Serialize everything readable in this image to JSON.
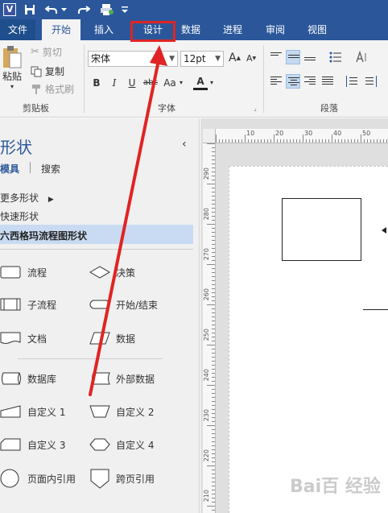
{
  "qat": {
    "app_icon": "V"
  },
  "tabs": [
    {
      "label": "文件"
    },
    {
      "label": "开始"
    },
    {
      "label": "插入"
    },
    {
      "label": "设计"
    },
    {
      "label": "数据"
    },
    {
      "label": "进程"
    },
    {
      "label": "审阅"
    },
    {
      "label": "视图"
    }
  ],
  "clipboard": {
    "paste": "粘贴",
    "cut": "剪切",
    "copy": "复制",
    "format_painter": "格式刷",
    "group": "剪贴板"
  },
  "font": {
    "name": "宋体",
    "size": "12pt",
    "grow": "A",
    "shrink": "A",
    "bold": "B",
    "italic": "I",
    "underline": "U",
    "strike": "abc",
    "case": "Aa",
    "color": "A",
    "group": "字体"
  },
  "paragraph": {
    "group": "段落"
  },
  "pane": {
    "title": "形状",
    "tab_stencils": "模具",
    "tab_search": "搜索",
    "more_shapes": "更多形状",
    "quick_shapes": "快速形状",
    "six_sigma": "六西格玛流程图形状",
    "collapse": "‹"
  },
  "shapes": [
    {
      "label": "流程"
    },
    {
      "label": "决策"
    },
    {
      "label": "子流程"
    },
    {
      "label": "开始/结束"
    },
    {
      "label": "文档"
    },
    {
      "label": "数据"
    },
    {
      "label": "数据库"
    },
    {
      "label": "外部数据"
    },
    {
      "label": "自定义 1"
    },
    {
      "label": "自定义 2"
    },
    {
      "label": "自定义 3"
    },
    {
      "label": "自定义 4"
    },
    {
      "label": "页面内引用"
    },
    {
      "label": "跨页引用"
    }
  ],
  "ruler_top": [
    "10",
    "20",
    "30",
    "40",
    "50"
  ],
  "ruler_left": [
    "290",
    "280",
    "270",
    "260",
    "250",
    "240",
    "230",
    "220",
    "210"
  ],
  "watermark": "Bai百 经验",
  "colors": {
    "ribbon_blue": "#2b579a",
    "annotation_red": "#e02424",
    "selected": "#c5d9ef",
    "highlight_row": "#c9dbf2"
  }
}
